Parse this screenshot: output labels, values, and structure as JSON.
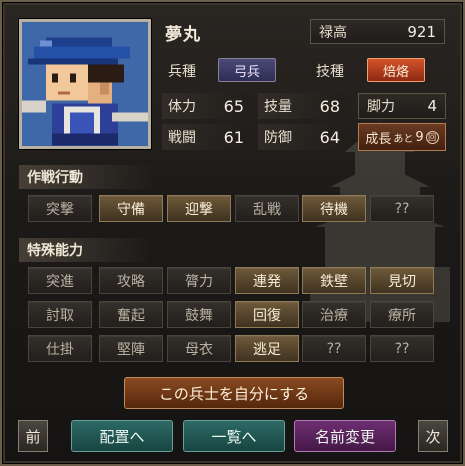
{
  "unit": {
    "name": "夢丸",
    "stipend_label": "禄高",
    "stipend_value": "921",
    "troop_type_label": "兵種",
    "troop_type_value": "弓兵",
    "technique_label": "技種",
    "technique_value": "焙烙"
  },
  "stats": {
    "stamina_label": "体力",
    "stamina_value": "65",
    "skill_label": "技量",
    "skill_value": "68",
    "legs_label": "脚力",
    "legs_value": "4",
    "combat_label": "戦闘",
    "combat_value": "61",
    "defense_label": "防御",
    "defense_value": "64",
    "growth_label": "成長",
    "growth_after": "あと",
    "growth_value": "9",
    "growth_unit": "回"
  },
  "tactics": {
    "title": "作戦行動",
    "buttons": [
      {
        "label": "突撃",
        "active": false
      },
      {
        "label": "守備",
        "active": true
      },
      {
        "label": "迎撃",
        "active": true
      },
      {
        "label": "乱戦",
        "active": false
      },
      {
        "label": "待機",
        "active": true
      },
      {
        "label": "??",
        "active": false
      }
    ]
  },
  "abilities": {
    "title": "特殊能力",
    "rows": [
      [
        {
          "label": "突進",
          "active": false
        },
        {
          "label": "攻略",
          "active": false
        },
        {
          "label": "膂力",
          "active": false
        },
        {
          "label": "連発",
          "active": true
        },
        {
          "label": "鉄壁",
          "active": true
        },
        {
          "label": "見切",
          "active": true
        }
      ],
      [
        {
          "label": "討取",
          "active": false
        },
        {
          "label": "奮起",
          "active": false
        },
        {
          "label": "鼓舞",
          "active": false
        },
        {
          "label": "回復",
          "active": true
        },
        {
          "label": "治療",
          "active": false
        },
        {
          "label": "療所",
          "active": false
        }
      ],
      [
        {
          "label": "仕掛",
          "active": false
        },
        {
          "label": "堅陣",
          "active": false
        },
        {
          "label": "母衣",
          "active": false
        },
        {
          "label": "逃足",
          "active": true
        },
        {
          "label": "??",
          "active": false
        },
        {
          "label": "??",
          "active": false
        }
      ]
    ]
  },
  "actions": {
    "make_own": "この兵士を自分にする",
    "prev": "前",
    "next": "次",
    "deploy": "配置へ",
    "list": "一覧へ",
    "rename": "名前変更"
  }
}
